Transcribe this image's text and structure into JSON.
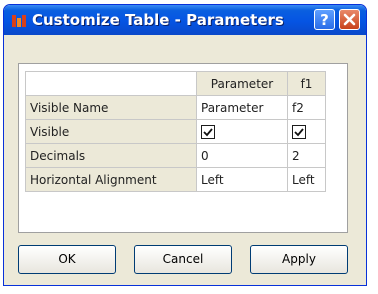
{
  "window": {
    "title": "Customize Table - Parameters",
    "help_glyph": "?",
    "icons": [
      "app-icon",
      "help-icon",
      "close-icon"
    ]
  },
  "table": {
    "columns": [
      "Parameter",
      "f1"
    ],
    "rows": [
      {
        "label": "Visible Name",
        "values": [
          "Parameter",
          "f2"
        ]
      },
      {
        "label": "Visible",
        "values": [
          true,
          true
        ]
      },
      {
        "label": "Decimals",
        "values": [
          "0",
          "2"
        ]
      },
      {
        "label": "Horizontal Alignment",
        "values": [
          "Left",
          "Left"
        ]
      }
    ]
  },
  "buttons": {
    "ok": "OK",
    "cancel": "Cancel",
    "apply": "Apply"
  },
  "colors": {
    "titlebar": "#0554e3",
    "dialog_bg": "#ece9d8",
    "close": "#c8411b"
  }
}
